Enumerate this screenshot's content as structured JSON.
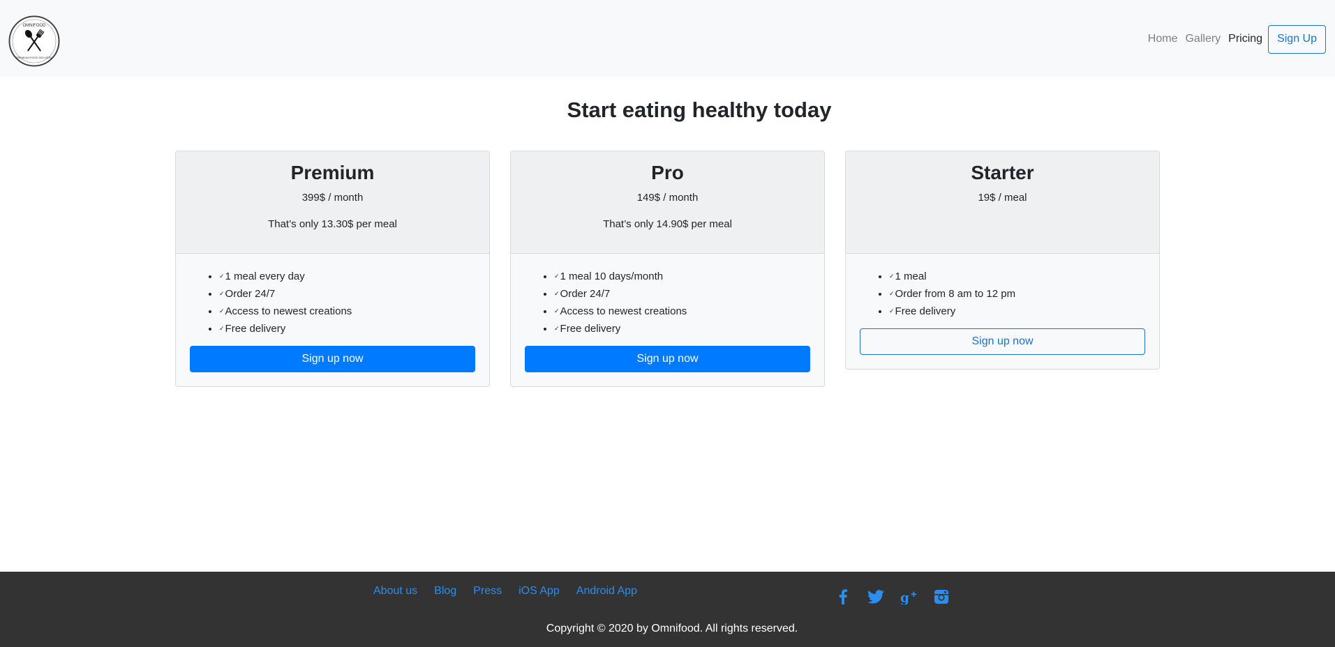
{
  "navbar": {
    "logo_text_top": "OMNIFOOD",
    "logo_text_bottom": "PREMIUM FOOD DELIVERY",
    "links": [
      {
        "label": "Home"
      },
      {
        "label": "Gallery"
      },
      {
        "label": "Pricing"
      }
    ],
    "signup_label": "Sign Up"
  },
  "main": {
    "title": "Start eating healthy today"
  },
  "plans": [
    {
      "name": "Premium",
      "price": "399$ / month",
      "note": "That’s only 13.30$ per meal",
      "features": [
        "1 meal every day",
        "Order 24/7",
        "Access to newest creations",
        "Free delivery"
      ],
      "cta": "Sign up now"
    },
    {
      "name": "Pro",
      "price": "149$ / month",
      "note": "That’s only 14.90$ per meal",
      "features": [
        "1 meal 10 days/month",
        "Order 24/7",
        "Access to newest creations",
        "Free delivery"
      ],
      "cta": "Sign up now"
    },
    {
      "name": "Starter",
      "price": "19$ / meal",
      "note": "",
      "features": [
        "1 meal",
        "Order from 8 am to 12 pm",
        "Free delivery"
      ],
      "cta": "Sign up now"
    }
  ],
  "check_glyph": "✓",
  "footer": {
    "links": [
      {
        "label": "About us"
      },
      {
        "label": "Blog"
      },
      {
        "label": "Press"
      },
      {
        "label": "iOS App"
      },
      {
        "label": "Android App"
      }
    ],
    "social_icons": [
      "facebook-icon",
      "twitter-icon",
      "google-plus-icon",
      "instagram-icon"
    ],
    "copyright": "Copyright © 2020 by Omnifood. All rights reserved."
  },
  "colors": {
    "accent": "#007bff",
    "nav_bg": "#f8f9fa",
    "footer_bg": "#333333",
    "link_blue": "#2a8ef0"
  }
}
